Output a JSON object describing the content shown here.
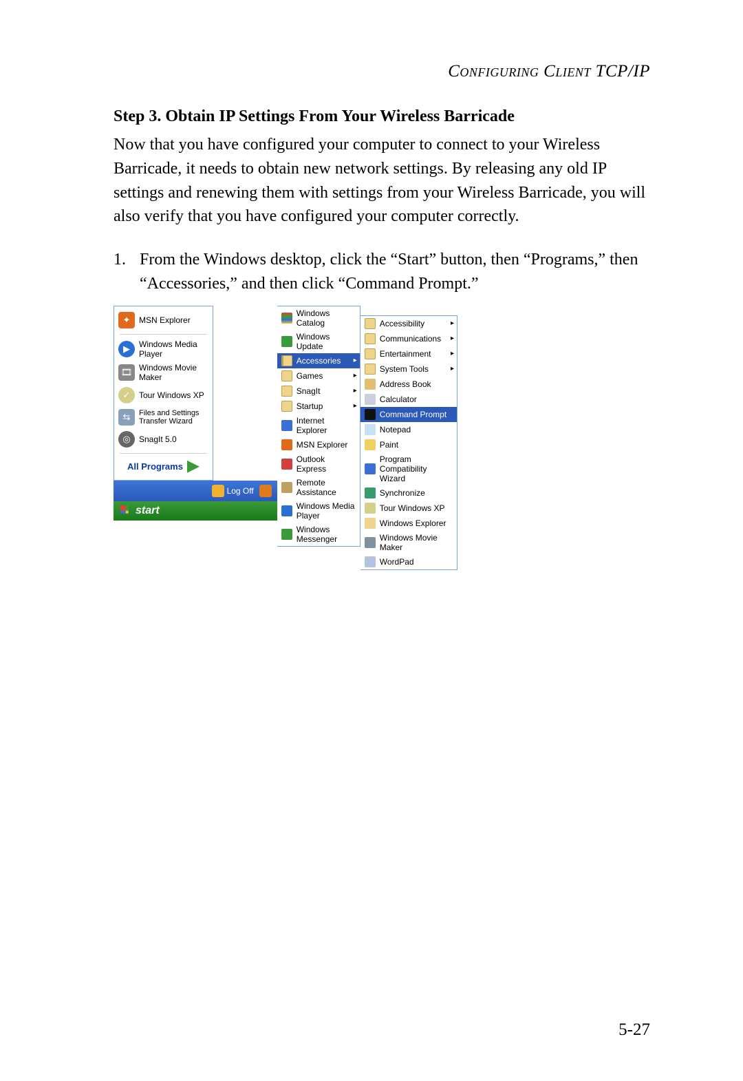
{
  "chapter_heading": "Configuring Client TCP/IP",
  "step_title": "Step 3. Obtain IP Settings From Your Wireless Barricade",
  "body_paragraph": "Now that you have configured your computer to connect to your Wireless Barricade, it needs to obtain new network settings. By releasing any old IP settings and renewing them with settings from your Wireless Barricade, you will also verify that you have configured your computer correctly.",
  "list_number": "1.",
  "list_text": "From the Windows desktop, click the “Start” button, then “Programs,” then “Accessories,” and then click “Command Prompt.”",
  "page_number": "5-27",
  "start_menu": {
    "left_items": [
      "MSN Explorer",
      "Windows Media Player",
      "Windows Movie Maker",
      "Tour Windows XP",
      "Files and Settings Transfer Wizard",
      "SnagIt 5.0"
    ],
    "all_programs": "All Programs",
    "log_off": "Log Off",
    "start": "start"
  },
  "programs_menu": {
    "items": [
      {
        "label": "Windows Catalog",
        "icon": "t-flag",
        "arrow": false
      },
      {
        "label": "Windows Update",
        "icon": "t-upd",
        "arrow": false
      },
      {
        "label": "Accessories",
        "icon": "t-fold-o",
        "arrow": true,
        "highlight": true
      },
      {
        "label": "Games",
        "icon": "t-fold",
        "arrow": true
      },
      {
        "label": "SnagIt",
        "icon": "t-fold",
        "arrow": true
      },
      {
        "label": "Startup",
        "icon": "t-fold",
        "arrow": true
      },
      {
        "label": "Internet Explorer",
        "icon": "t-ie",
        "arrow": false
      },
      {
        "label": "MSN Explorer",
        "icon": "t-msn",
        "arrow": false
      },
      {
        "label": "Outlook Express",
        "icon": "t-oe",
        "arrow": false
      },
      {
        "label": "Remote Assistance",
        "icon": "t-ra",
        "arrow": false
      },
      {
        "label": "Windows Media Player",
        "icon": "t-play",
        "arrow": false
      },
      {
        "label": "Windows Messenger",
        "icon": "t-msgr",
        "arrow": false
      }
    ]
  },
  "accessories_menu": {
    "items": [
      {
        "label": "Accessibility",
        "icon": "t-fold",
        "arrow": true
      },
      {
        "label": "Communications",
        "icon": "t-fold",
        "arrow": true
      },
      {
        "label": "Entertainment",
        "icon": "t-fold",
        "arrow": true
      },
      {
        "label": "System Tools",
        "icon": "t-fold",
        "arrow": true
      },
      {
        "label": "Address Book",
        "icon": "t-book",
        "arrow": false
      },
      {
        "label": "Calculator",
        "icon": "t-calc",
        "arrow": false
      },
      {
        "label": "Command Prompt",
        "icon": "t-cmd",
        "arrow": false,
        "highlight": true
      },
      {
        "label": "Notepad",
        "icon": "t-note",
        "arrow": false
      },
      {
        "label": "Paint",
        "icon": "t-paint",
        "arrow": false
      },
      {
        "label": "Program Compatibility Wizard",
        "icon": "t-help",
        "arrow": false
      },
      {
        "label": "Synchronize",
        "icon": "t-sync",
        "arrow": false
      },
      {
        "label": "Tour Windows XP",
        "icon": "t-tour",
        "arrow": false
      },
      {
        "label": "Windows Explorer",
        "icon": "t-exp",
        "arrow": false
      },
      {
        "label": "Windows Movie Maker",
        "icon": "t-mov",
        "arrow": false
      },
      {
        "label": "WordPad",
        "icon": "t-wp",
        "arrow": false
      }
    ]
  }
}
